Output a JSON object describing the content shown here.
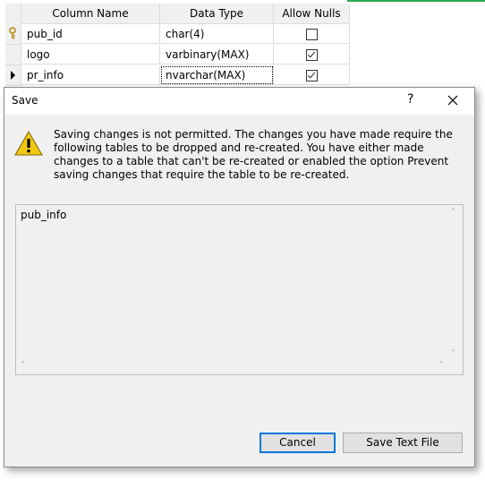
{
  "grid": {
    "headers": [
      "Column Name",
      "Data Type",
      "Allow Nulls"
    ],
    "rows": [
      {
        "name": "pub_id",
        "type": "char(4)",
        "allow_nulls": false,
        "key": true,
        "current": false
      },
      {
        "name": "logo",
        "type": "varbinary(MAX)",
        "allow_nulls": true,
        "key": false,
        "current": false
      },
      {
        "name": "pr_info",
        "type": "nvarchar(MAX)",
        "allow_nulls": true,
        "key": false,
        "current": true
      }
    ]
  },
  "dialog": {
    "title": "Save",
    "help_glyph": "?",
    "message": "Saving changes is not permitted. The changes you have made require the following tables to be dropped and re-created. You have either made changes to a table that can't be re-created or enabled the option Prevent saving changes that require the table to be re-created.",
    "tables": [
      "pub_info"
    ],
    "buttons": {
      "cancel": "Cancel",
      "save_text_file": "Save Text File"
    }
  },
  "icons": {
    "warning": "warning-icon",
    "key": "key-icon",
    "row_pointer": "row-pointer-icon",
    "close": "close-icon"
  },
  "colors": {
    "accent": "#0078d7",
    "warning": "#f2c811",
    "green_line": "#2fa84f"
  }
}
